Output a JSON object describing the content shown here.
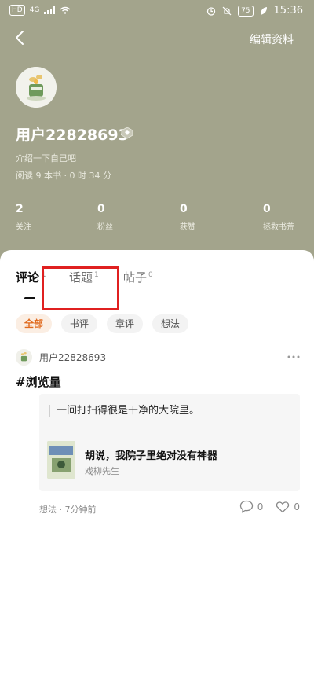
{
  "status_bar": {
    "hd": "HD",
    "signal": "4G",
    "battery": "75",
    "time": "15:36"
  },
  "header": {
    "edit_profile": "编辑资料"
  },
  "profile": {
    "username": "用户22828693",
    "bio": "介绍一下自己吧",
    "reading_stats": "阅读 9 本书 · 0 时 34 分"
  },
  "stats": [
    {
      "value": "2",
      "label": "关注"
    },
    {
      "value": "0",
      "label": "粉丝"
    },
    {
      "value": "0",
      "label": "获赞"
    },
    {
      "value": "0",
      "label": "拯救书荒"
    }
  ],
  "tabs": [
    {
      "label": "评论",
      "count": "1"
    },
    {
      "label": "话题",
      "count": "1"
    },
    {
      "label": "帖子",
      "count": "0"
    }
  ],
  "filters": [
    "全部",
    "书评",
    "章评",
    "想法"
  ],
  "post": {
    "username": "用户22828693",
    "title": "#浏览量",
    "quote": "一间打扫得很是干净的大院里。",
    "book_title": "胡说，我院子里绝对没有神器",
    "book_author": "戏柳先生",
    "meta": "想法 · 7分钟前",
    "comments": "0",
    "likes": "0"
  },
  "colors": {
    "header_bg": "#a3a48c",
    "accent": "#e06a1e",
    "highlight": "#e02020"
  }
}
